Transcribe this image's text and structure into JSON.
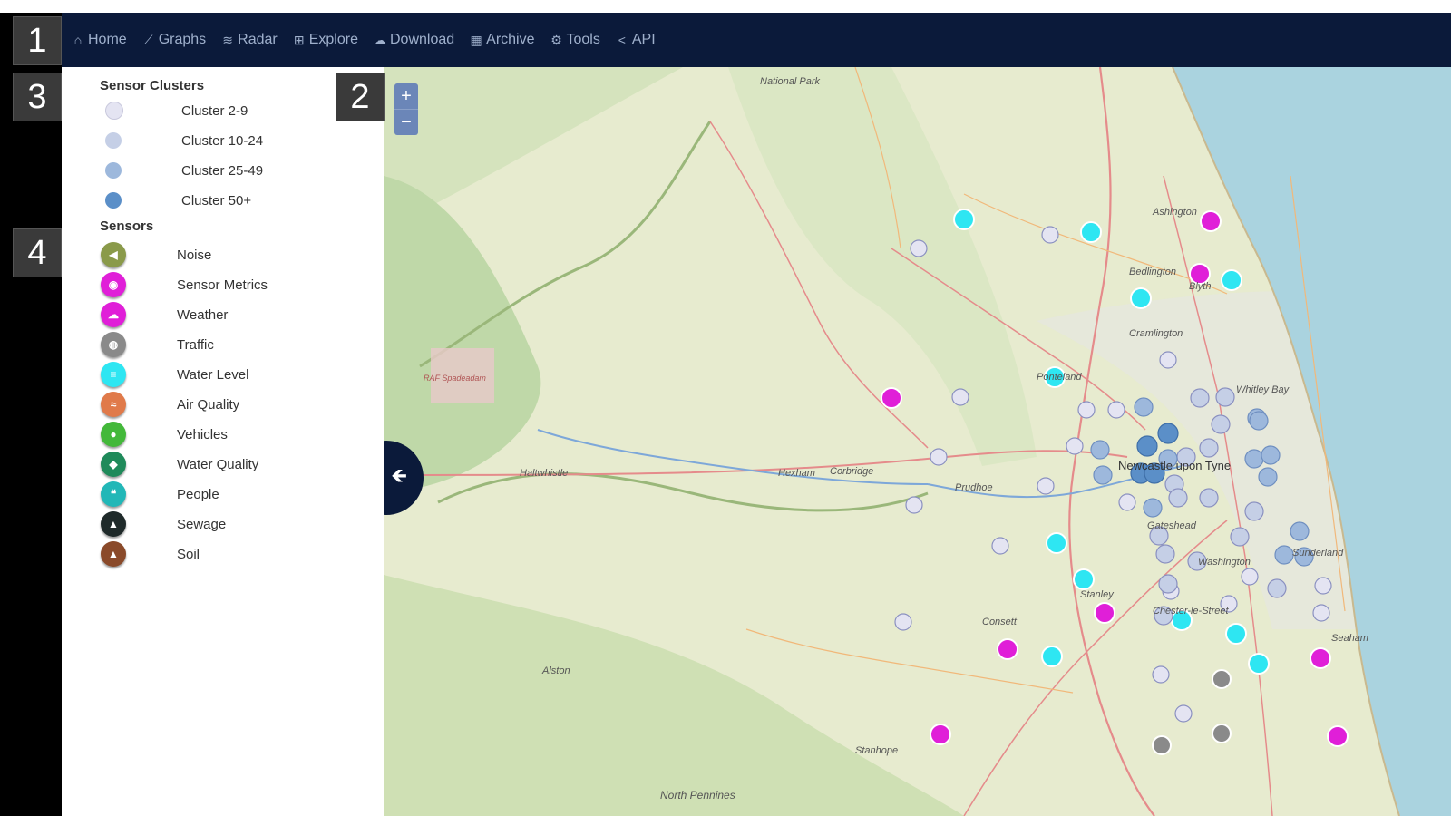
{
  "nav": {
    "items": [
      {
        "label": "Home",
        "icon": "home-icon"
      },
      {
        "label": "Graphs",
        "icon": "line-chart-icon"
      },
      {
        "label": "Radar",
        "icon": "wifi-icon"
      },
      {
        "label": "Explore",
        "icon": "sitemap-icon"
      },
      {
        "label": "Download",
        "icon": "cloud-download-icon"
      },
      {
        "label": "Archive",
        "icon": "table-icon"
      },
      {
        "label": "Tools",
        "icon": "cogs-icon"
      },
      {
        "label": "API",
        "icon": "share-icon"
      }
    ]
  },
  "badges": {
    "one": "1",
    "two": "2",
    "three": "3",
    "four": "4"
  },
  "legend": {
    "clusters_title": "Sensor Clusters",
    "clusters": [
      {
        "label": "Cluster 2-9",
        "color": "#e4e4f2"
      },
      {
        "label": "Cluster 10-24",
        "color": "#c5cfe6"
      },
      {
        "label": "Cluster 25-49",
        "color": "#9db8dc"
      },
      {
        "label": "Cluster 50+",
        "color": "#5b8fc8"
      }
    ],
    "sensors_title": "Sensors",
    "sensors": [
      {
        "label": "Noise",
        "color": "#8a9a4a",
        "icon": "speaker-icon"
      },
      {
        "label": "Sensor Metrics",
        "color": "#e01fd8",
        "icon": "gauge-icon"
      },
      {
        "label": "Weather",
        "color": "#e01fd8",
        "icon": "cloud-icon"
      },
      {
        "label": "Traffic",
        "color": "#8a8a8a",
        "icon": "car-icon"
      },
      {
        "label": "Water Level",
        "color": "#2ee6f2",
        "icon": "water-level-icon"
      },
      {
        "label": "Air Quality",
        "color": "#e07a4a",
        "icon": "smoke-icon"
      },
      {
        "label": "Vehicles",
        "color": "#43b83a",
        "icon": "vehicle-icon"
      },
      {
        "label": "Water Quality",
        "color": "#1f8a5a",
        "icon": "droplet-icon"
      },
      {
        "label": "People",
        "color": "#22b7b7",
        "icon": "people-icon"
      },
      {
        "label": "Sewage",
        "color": "#1f2a2a",
        "icon": "sewage-icon"
      },
      {
        "label": "Soil",
        "color": "#8a4a2a",
        "icon": "soil-icon"
      }
    ]
  },
  "map": {
    "zoom_in": "+",
    "zoom_out": "−",
    "collapse_glyph": "🡸",
    "places": [
      "National Park",
      "Newcastle upon Tyne",
      "North Pennines",
      "Haltwhistle",
      "Hexham",
      "Corbridge",
      "Consett",
      "Stanley",
      "Blyth",
      "Whitley Bay",
      "Cramlington",
      "Ashington",
      "Bedlington",
      "Prudhoe",
      "Gateshead",
      "Sunderland",
      "Chester-le-Street",
      "Washington",
      "Seaham",
      "Ponteland",
      "Alston",
      "Stanhope",
      "RAF Spadeadam"
    ]
  }
}
